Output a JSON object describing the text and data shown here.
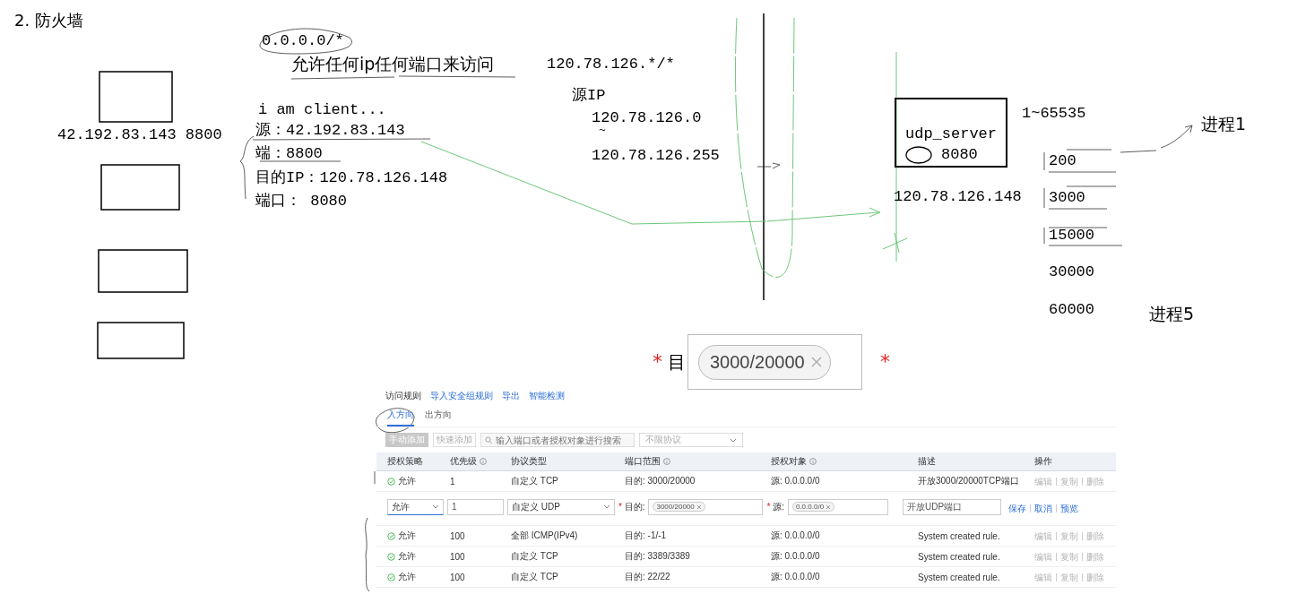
{
  "heading": "2. 防火墙",
  "notes": [
    {
      "text": "0.0.0.0/*"
    },
    {
      "text": "允许任何ip任何端口来访问"
    },
    {
      "text": "120.78.126.*/*"
    },
    {
      "text": "源IP"
    },
    {
      "text": "120.78.126.0"
    },
    {
      "text": "~"
    },
    {
      "text": "120.78.126.255"
    },
    {
      "text": "i am client..."
    },
    {
      "text": "源：42.192.83.143"
    },
    {
      "text": "端：8800"
    },
    {
      "text": "目的IP：120.78.126.148"
    },
    {
      "text": "端口： 8080"
    },
    {
      "text": "42.192.83.143 8800"
    },
    {
      "text": "1~65535"
    },
    {
      "text": "120.78.126.148"
    },
    {
      "text": "200"
    },
    {
      "text": "3000"
    },
    {
      "text": "15000"
    },
    {
      "text": "30000"
    },
    {
      "text": "60000"
    },
    {
      "text": "进程1"
    },
    {
      "text": "进程5"
    }
  ],
  "server": {
    "name": "udp_server",
    "port": "8080"
  },
  "zoom_callout": {
    "required_mark": "*",
    "label": "目",
    "tag": "3000/20000",
    "trailing_mark": "*"
  },
  "console": {
    "title": "访问规则",
    "links": [
      "导入安全组规则",
      "导出",
      "智能检测"
    ],
    "tabs": [
      {
        "label": "入方向",
        "selected": true
      },
      {
        "label": "出方向",
        "selected": false
      }
    ],
    "buttons": [
      {
        "label": "手动添加",
        "kind": "primary"
      },
      {
        "label": "快速添加",
        "kind": "secondary"
      }
    ],
    "search": {
      "placeholder": "输入端口或者授权对象进行搜索"
    },
    "filter": {
      "value": "不限协议"
    },
    "columns": [
      {
        "label": "授权策略",
        "info": false
      },
      {
        "label": "优先级",
        "info": true
      },
      {
        "label": "协议类型",
        "info": false
      },
      {
        "label": "端口范围",
        "info": true
      },
      {
        "label": "授权对象",
        "info": true
      },
      {
        "label": "描述",
        "info": false
      },
      {
        "label": "操作",
        "info": false
      }
    ],
    "rows": [
      {
        "kind": "rule",
        "policy": "允许",
        "priority": "1",
        "protocol": "自定义 TCP",
        "port": "目的: 3000/20000",
        "source": "源: 0.0.0.0/0",
        "description": "开放3000/20000TCP端口",
        "actions": [
          "编辑",
          "复制",
          "删除"
        ]
      },
      {
        "kind": "edit",
        "policy": "允许",
        "priority": "1",
        "protocol": "自定义 UDP",
        "required_mark": "*",
        "port_label": "目的:",
        "port_tag": "3000/20000",
        "source_label": "源:",
        "source_tag": "0.0.0.0/0",
        "description": "开放UDP端口",
        "actions": [
          "保存",
          "取消",
          "预览"
        ]
      },
      {
        "kind": "rule",
        "policy": "允许",
        "priority": "100",
        "protocol": "全部 ICMP(IPv4)",
        "port": "目的: -1/-1",
        "source": "源: 0.0.0.0/0",
        "description": "System created rule.",
        "actions": [
          "编辑",
          "复制",
          "删除"
        ]
      },
      {
        "kind": "rule",
        "policy": "允许",
        "priority": "100",
        "protocol": "自定义 TCP",
        "port": "目的: 3389/3389",
        "source": "源: 0.0.0.0/0",
        "description": "System created rule.",
        "actions": [
          "编辑",
          "复制",
          "删除"
        ]
      },
      {
        "kind": "rule",
        "policy": "允许",
        "priority": "100",
        "protocol": "自定义 TCP",
        "port": "目的: 22/22",
        "source": "源: 0.0.0.0/0",
        "description": "System created rule.",
        "actions": [
          "编辑",
          "复制",
          "删除"
        ]
      }
    ]
  }
}
